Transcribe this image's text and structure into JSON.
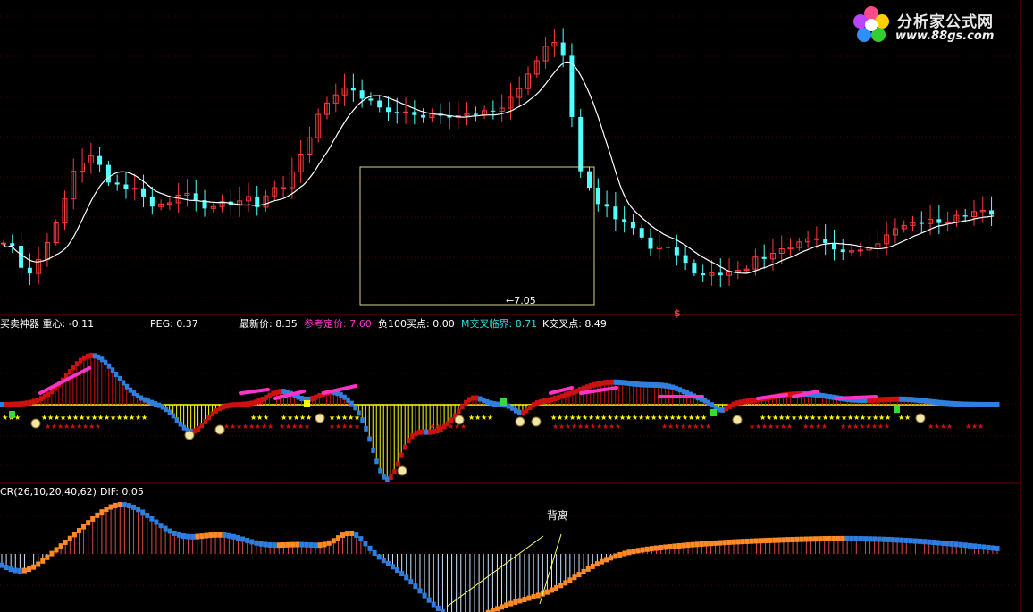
{
  "watermark": {
    "title": "分析家公式网",
    "url": "www.88gs.com"
  },
  "colors": {
    "up": "#ff3b3b",
    "down": "#54ffff",
    "ma": "#ffffff",
    "box": "#d8d48a",
    "grid": "#4a0000",
    "panel_sep": "#6b0000",
    "ind_red": "#cc1111",
    "ind_blue": "#2f7fe0",
    "ind_magenta": "#ff33cc",
    "ind_cyan": "#33dddd",
    "ind_yellow": "#ffff00",
    "ind_green": "#33dd33",
    "cr_orange": "#ff8a26",
    "cr_blue": "#2e7de0"
  },
  "main_panel": {
    "low_marker": "←7.05",
    "dollar_marker": "$"
  },
  "indicator_panel": {
    "legend": [
      {
        "text": "买卖神器  重心: -0.11",
        "color": "#ffffff"
      },
      {
        "text": "PEG: 0.37",
        "color": "#ffffff"
      },
      {
        "text": "最新价: 8.35",
        "color": "#ffffff"
      },
      {
        "text": "参考定价: 7.60",
        "color": "#ff33cc"
      },
      {
        "text": "负100买点: 0.00",
        "color": "#ffffff"
      },
      {
        "text": "M交叉临界: 8.71",
        "color": "#33dddd"
      },
      {
        "text": "K交叉点: 8.49",
        "color": "#ffffff"
      }
    ],
    "stars": "★★★★★★★★"
  },
  "cr_panel": {
    "legend": [
      {
        "text": "CR(26,10,20,40,62)",
        "color": "#ffffff"
      },
      {
        "text": "DIF: 0.05",
        "color": "#ffffff"
      }
    ],
    "annotation": "背离"
  },
  "chart_data": [
    {
      "type": "candlestick",
      "title": "",
      "series": [
        {
          "name": "",
          "values": [
            7.86,
            7.74,
            7.8,
            7.86,
            7.82,
            7.49,
            7.56,
            7.52,
            7.47,
            7.43,
            7.42,
            7.33,
            7.38,
            7.39,
            7.45,
            7.47,
            7.6,
            7.7,
            7.71,
            7.79,
            7.87,
            7.94,
            8.0,
            8.14,
            8.18,
            8.21,
            8.32,
            8.43,
            8.56,
            8.64,
            8.76,
            8.82,
            9.0,
            9.05,
            9.18,
            9.19,
            9.13,
            9.18,
            9.21,
            9.29,
            9.24,
            9.21,
            9.15,
            9.13,
            9.1,
            8.99,
            8.86,
            8.82,
            8.82,
            8.81,
            8.8,
            8.74,
            8.79,
            8.74,
            8.83,
            8.71,
            8.72,
            8.75,
            8.79,
            8.8,
            8.73,
            8.61,
            8.59,
            8.56,
            8.6,
            8.64,
            8.48,
            8.43,
            8.44,
            8.47,
            8.43,
            8.49,
            8.48,
            8.5,
            8.48,
            8.49,
            8.5,
            8.56,
            8.62,
            8.56,
            8.62,
            8.57,
            8.58,
            8.59,
            8.65,
            8.56,
            8.57,
            8.54,
            8.54,
            8.55,
            8.46,
            8.46,
            8.41,
            8.31,
            8.35,
            8.35,
            8.44,
            8.42,
            8.45,
            8.49,
            8.52,
            8.47,
            8.52,
            8.49,
            8.46,
            8.4,
            8.43,
            8.47,
            8.53,
            8.47,
            8.5,
            8.58,
            8.6,
            8.5,
            8.39,
            8.45,
            8.43,
            8.46,
            8.5,
            8.54,
            8.61,
            8.7,
            8.8,
            8.76,
            8.74,
            8.67,
            8.71,
            8.76,
            8.74,
            8.85,
            8.93,
            8.91,
            8.99,
            9.11,
            9.19,
            9.2,
            9.27,
            9.22,
            9.33,
            9.41,
            9.53,
            9.53,
            9.65,
            9.8,
            9.9,
            9.99,
            10.01,
            10.05,
            10.08,
            10.15,
            10.23,
            10.28,
            10.21,
            10.31,
            10.27,
            10.32,
            10.32,
            10.39,
            10.36,
            10.23,
            10.28,
            10.26,
            10.21,
            10.2,
            10.15,
            10.17,
            10.11,
            10.06,
            10.12,
            10.12,
            10.02,
            10.02,
            10.01,
            10.06,
            9.95,
            9.91,
            9.94,
            9.98,
            9.96,
            9.95,
            9.93,
            10.0,
            9.92,
            9.99,
            9.94,
            9.94,
            9.84,
            9.85,
            9.89,
            9.8,
            9.76,
            9.84,
            9.85,
            9.84,
            9.9,
            9.89,
            9.91,
            9.84,
            9.91,
            9.94,
            9.88,
            9.86,
            9.81,
            9.79,
            9.85,
            9.89,
            9.81,
            9.91,
            9.88,
            9.86,
            9.85,
            9.86,
            9.91,
            9.95,
            9.96,
            9.85,
            9.89,
            9.88,
            10.0,
            10.0,
            9.96,
            9.89,
            9.88,
            9.91,
            9.95,
            9.95,
            9.97,
            9.94,
            10.0,
            10.05,
            10.14,
            10.15,
            10.17,
            10.26,
            10.31,
            10.34,
            10.31,
            10.41,
            10.43,
            10.48,
            10.54,
            10.54,
            10.57,
            10.7,
            10.75,
            10.81,
            10.89,
            10.93,
            10.98,
            11.08,
            11.17,
            11.06,
            11.04,
            11.02,
            11.07,
            11.03,
            10.83,
            10.66,
            10.37,
            10.13,
            9.86,
            9.55,
            9.32,
            9.1,
            9.0,
            8.9,
            8.79,
            8.75,
            8.74,
            8.6,
            8.58,
            8.52,
            8.48,
            8.45,
            8.33,
            8.39,
            8.44,
            8.37,
            8.31,
            8.18,
            8.24,
            8.16,
            8.12,
            8.09,
            8.19,
            8.1,
            8.08,
            8.07,
            8.1,
            8.05,
            8.07,
            8.03,
            7.95,
            7.97,
            7.89,
            7.78,
            7.77,
            7.85,
            7.82,
            7.77,
            7.8,
            7.88,
            7.8,
            7.88,
            7.79,
            7.84,
            7.84,
            7.78,
            7.67,
            7.65,
            7.59,
            7.55,
            7.55,
            7.49,
            7.46,
            7.43,
            7.38,
            7.32,
            7.35,
            7.31,
            7.35,
            7.31,
            7.3,
            7.32,
            7.39,
            7.36,
            7.36,
            7.38,
            7.35,
            7.38,
            7.34,
            7.37,
            7.41,
            7.49,
            7.45,
            7.46,
            7.43,
            7.46,
            7.43,
            7.43,
            7.45,
            7.55,
            7.58,
            7.6,
            7.64,
            7.62,
            7.63,
            7.62,
            7.61,
            7.65,
            7.69,
            7.7,
            7.7,
            7.72,
            7.72,
            7.75,
            7.77,
            7.79,
            7.78,
            7.77,
            7.79,
            7.8,
            7.82,
            7.85,
            7.88,
            7.86,
            7.92,
            7.93,
            7.93,
            7.96,
            7.97,
            7.98,
            7.93,
            7.91,
            7.89,
            7.87,
            7.86,
            7.81,
            7.8,
            7.83,
            7.76,
            7.74,
            7.7,
            7.74,
            7.72,
            7.66,
            7.73,
            7.76,
            7.74,
            7.74,
            7.72,
            7.72,
            7.75,
            7.79,
            7.77,
            7.8,
            7.8,
            7.86,
            7.8,
            7.82,
            7.85,
            7.88,
            7.89,
            7.94,
            7.99,
            8.02,
            8.0,
            8.0,
            8.09,
            8.11,
            8.06,
            8.14,
            8.14,
            8.13,
            8.08,
            8.18,
            8.18,
            8.14,
            8.1,
            8.11,
            8.17,
            8.18,
            8.21,
            8.2,
            8.24,
            8.26,
            8.2,
            8.2,
            8.18,
            8.16,
            8.2,
            8.21,
            8.19,
            8.27,
            8.23,
            8.25,
            8.3,
            8.31,
            8.28,
            8.33,
            8.28,
            8.29,
            8.27,
            8.3,
            8.36,
            8.36,
            8.31,
            8.36,
            8.38,
            8.34,
            8.31,
            8.35,
            8.31,
            8.3
          ]
        }
      ],
      "low_label": 7.05,
      "ylim": [
        6.9,
        11.6
      ],
      "grid": true
    },
    {
      "type": "bar",
      "title": "",
      "categories": [],
      "values": [],
      "annotations": [
        "★"
      ]
    },
    {
      "type": "bar",
      "title": "",
      "annotations": [
        "背离"
      ]
    }
  ]
}
